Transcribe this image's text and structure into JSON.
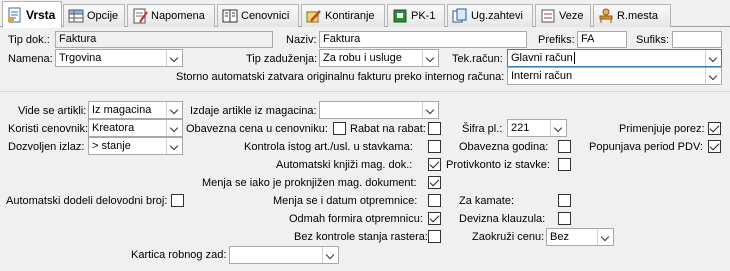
{
  "tabs": [
    {
      "label": "Vrsta",
      "icon": "document-icon"
    },
    {
      "label": "Opcije",
      "icon": "table-icon"
    },
    {
      "label": "Napomena",
      "icon": "note-icon"
    },
    {
      "label": "Cenovnici",
      "icon": "ledger-icon"
    },
    {
      "label": "Kontiranje",
      "icon": "pencil-icon"
    },
    {
      "label": "PK-1",
      "icon": "book-icon"
    },
    {
      "label": "Ug.zahtevi",
      "icon": "contracts-icon"
    },
    {
      "label": "Veze",
      "icon": "links-icon"
    },
    {
      "label": "R.mesta",
      "icon": "desk-icon"
    }
  ],
  "form": {
    "tip_dok_label": "Tip dok.:",
    "tip_dok_value": "Faktura",
    "naziv_label": "Naziv:",
    "naziv_value": "Faktura",
    "prefiks_label": "Prefiks:",
    "prefiks_value": "FA",
    "sufiks_label": "Sufiks:",
    "sufiks_value": "",
    "namena_label": "Namena:",
    "namena_value": "Trgovina",
    "tip_zaduzenja_label": "Tip zaduženja:",
    "tip_zaduzenja_value": "Za robu i usluge",
    "tek_racun_label": "Tek.račun:",
    "tek_racun_value": "Glavni račun",
    "storno_label": "Storno automatski zatvara originalnu fakturu preko internog računa:",
    "storno_value": "Interni račun",
    "vide_se_label": "Vide se artikli:",
    "vide_se_value": "Iz magacina",
    "izdaje_label": "Izdaje artikle iz magacina:",
    "izdaje_value": "",
    "koristi_label": "Koristi cenovnik:",
    "koristi_value": "Kreatora",
    "obavezna_cena_label": "Obavezna cena u cenovniku:",
    "rabat_label": "Rabat na rabat:",
    "sifra_label": "Šifra pl.:",
    "sifra_value": "221",
    "primenjuje_label": "Primenjuje porez:",
    "dozvoljen_label": "Dozvoljen izlaz:",
    "dozvoljen_value": "> stanje",
    "kontrola_label": "Kontrola istog art./usl. u stavkama:",
    "obavezna_godina_label": "Obavezna godina:",
    "popunjava_label": "Popunjava period PDV:",
    "automatski_knjizi_label": "Automatski knjiži mag. dok.:",
    "protivkonto_label": "Protivkonto iz stavke:",
    "menja_se_label": "Menja se iako je proknjižen mag. dokument:",
    "automatski_dodeli_label": "Automatski dodeli delovodni broj:",
    "menja_datum_label": "Menja se i datum otpremnice:",
    "za_kamate_label": "Za kamate:",
    "odmah_label": "Odmah formira otpremnicu:",
    "devizna_label": "Devizna klauzula:",
    "bez_kontrole_label": "Bez kontrole stanja rastera:",
    "zaokruzi_label": "Zaokruži cenu:",
    "zaokruzi_value": "Bez",
    "kartica_label": "Kartica robnog zad:",
    "kartica_value": ""
  },
  "checks": {
    "obavezna_cena": false,
    "rabat": false,
    "primenjuje": true,
    "kontrola": false,
    "obavezna_godina": false,
    "popunjava": true,
    "automatski_knjizi": true,
    "protivkonto": false,
    "menja_se": true,
    "automatski_dodeli": false,
    "menja_datum": false,
    "za_kamate": false,
    "odmah": true,
    "devizna": false,
    "bez_kontrole": false
  }
}
